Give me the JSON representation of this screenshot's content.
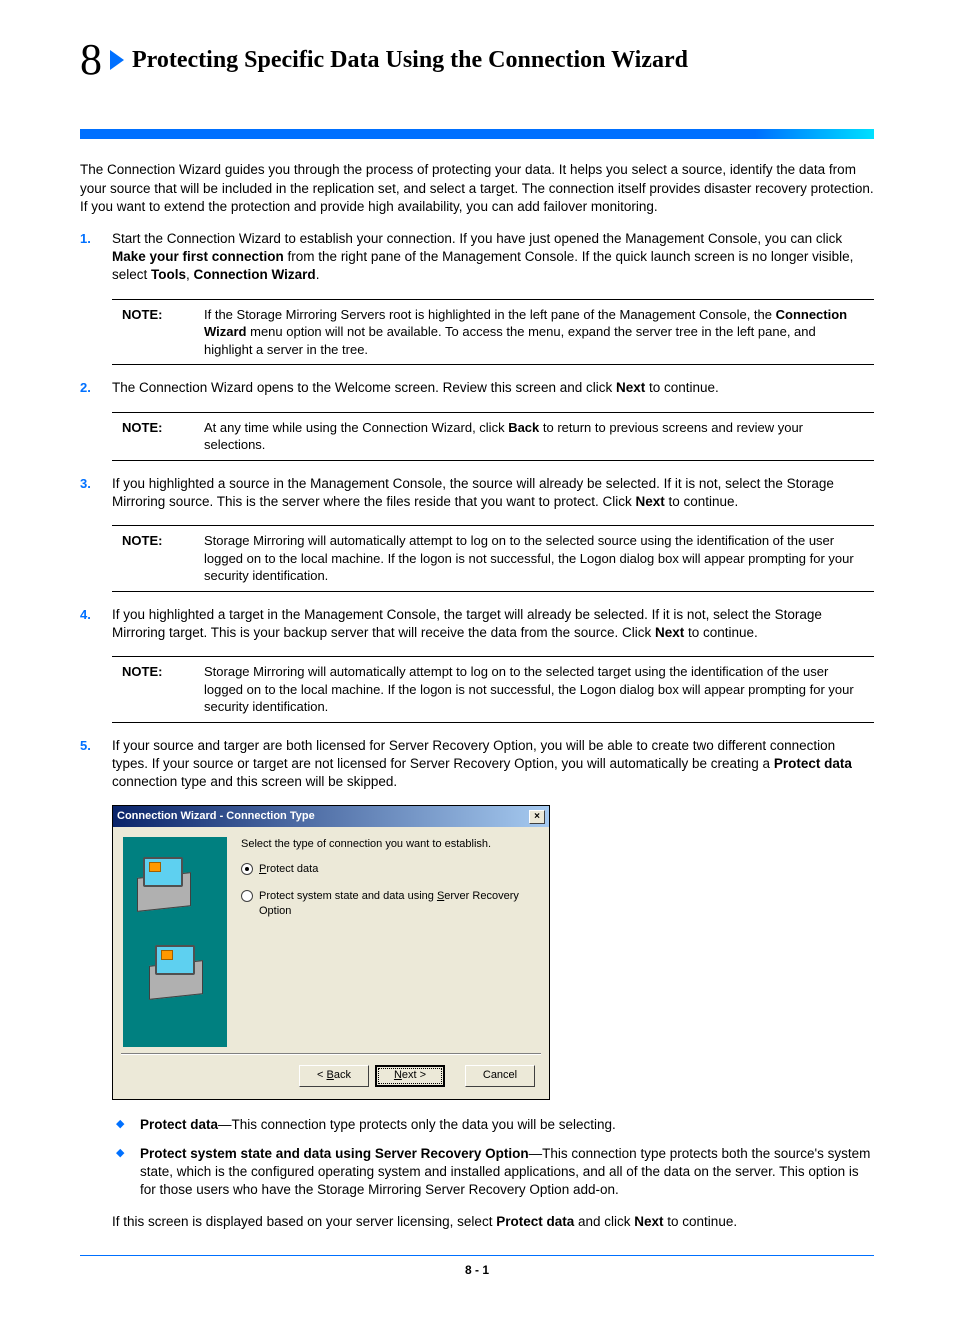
{
  "chapter": {
    "number": "8",
    "title": "Protecting Specific Data Using the Connection Wizard"
  },
  "intro": "The Connection Wizard guides you through the process of protecting your data. It helps you select a source, identify the data from your source that will be included in the replication set, and select a target. The connection itself provides disaster recovery protection. If you want to extend the protection and provide high availability, you can add failover monitoring.",
  "steps": {
    "s1_a": "Start the Connection Wizard to establish your connection. If you have just opened the Management Console, you can click ",
    "s1_b": "Make your first connection",
    "s1_c": " from the right pane of the Management Console. If the quick launch screen is no longer visible, select ",
    "s1_d": "Tools",
    "s1_e": ", ",
    "s1_f": "Connection Wizard",
    "s1_g": ".",
    "s2_a": "The Connection Wizard opens to the Welcome screen. Review this screen and click ",
    "s2_b": "Next",
    "s2_c": " to continue.",
    "s3_a": "If you highlighted a source in the Management Console, the source will already be selected. If it is not, select the Storage Mirroring source. This is the server where the files reside that you want to protect. Click ",
    "s3_b": "Next",
    "s3_c": " to continue.",
    "s4_a": "If you highlighted a target in the Management Console, the target will already be selected. If it is not, select the Storage Mirroring target. This is your backup server that will receive the data from the source. Click ",
    "s4_b": "Next",
    "s4_c": " to continue.",
    "s5_a": "If your source and targer are both licensed for Server Recovery Option, you will be able to create two different connection types. If your source or target are not licensed for Server Recovery Option, you will automatically be creating a ",
    "s5_b": "Protect data",
    "s5_c": " connection type and this screen will be skipped."
  },
  "notes": {
    "label": "NOTE:",
    "n1_a": "If the Storage Mirroring Servers root is highlighted in the left pane of the Management Console, the ",
    "n1_b": "Connection Wizard",
    "n1_c": " menu option will not be available. To access the menu, expand the server tree in the left pane, and highlight a server in the tree.",
    "n2_a": "At any time while using the Connection Wizard, click ",
    "n2_b": "Back",
    "n2_c": " to return to previous screens and review your selections.",
    "n3": "Storage Mirroring will automatically attempt to log on to the selected source using the identification of the user logged on to the local machine. If the logon is not successful, the Logon dialog box will appear prompting for your security identification.",
    "n4": "Storage Mirroring will automatically attempt to log on to the selected target using the identification of the user logged on to the local machine. If the logon is not successful, the Logon dialog box will appear prompting for your security identification."
  },
  "wizard": {
    "title": "Connection Wizard - Connection Type",
    "close": "×",
    "instruction": "Select the type of connection you want to establish.",
    "opt1_u": "P",
    "opt1_rest": "rotect data",
    "opt2_a": "Protect system state and data using ",
    "opt2_u": "S",
    "opt2_b": "erver Recovery Option",
    "back_lt": "<",
    "back_u": "B",
    "back_rest": "ack",
    "next_u": "N",
    "next_rest": "ext >",
    "cancel": "Cancel"
  },
  "bullets": {
    "b1_t": "Protect data",
    "b1_r": "—This connection type protects only the data you will be selecting.",
    "b2_t": "Protect system state and data using Server Recovery Option",
    "b2_r": "—This connection type protects both the source's system state, which is the configured operating system and installed applications, and all of the data on the server. This option is for those users who have the Storage Mirroring Server Recovery Option add-on."
  },
  "post_a": "If this screen is displayed based on your server licensing, select ",
  "post_b": "Protect data",
  "post_c": " and click ",
  "post_d": "Next",
  "post_e": " to continue.",
  "page_number": "8 - 1"
}
